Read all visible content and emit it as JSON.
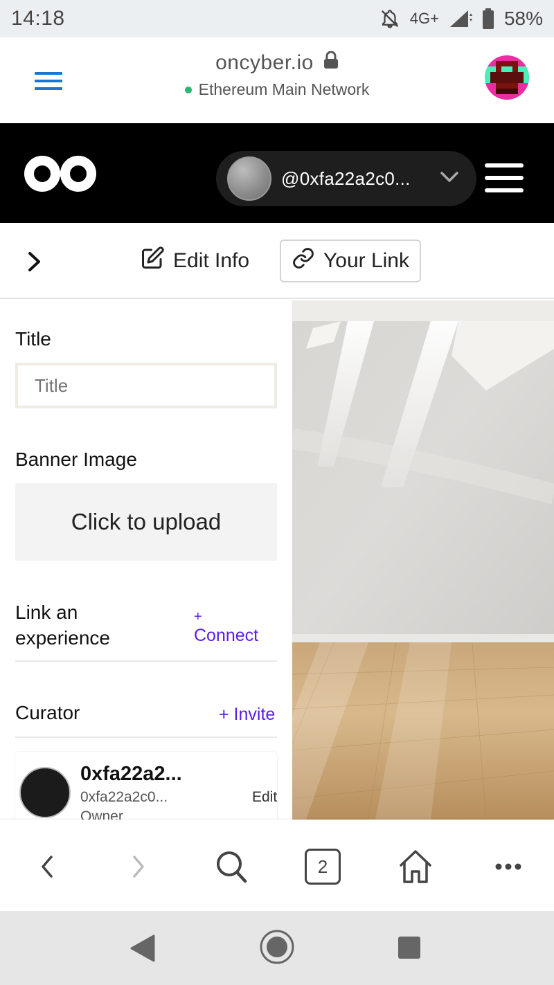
{
  "status_bar": {
    "time": "14:18",
    "network": "4G+",
    "battery": "58%",
    "icons": [
      "bell-off-icon",
      "signal-icon",
      "battery-icon"
    ]
  },
  "browser": {
    "domain": "oncyber.io",
    "network_label": "Ethereum Main Network",
    "network_color": "#2bb673",
    "icons": [
      "hamburger-icon",
      "lock-icon",
      "avatar"
    ],
    "tab_count": "2",
    "nav_icons": [
      "back-icon",
      "forward-icon",
      "search-icon",
      "tabs-icon",
      "home-icon",
      "more-icon"
    ]
  },
  "app": {
    "account_name": "@0xfa22a2c0...",
    "icons": [
      "oncyber-logo",
      "chevron-down-icon",
      "menu-icon"
    ]
  },
  "toolbar": {
    "edit_info_label": "Edit Info",
    "your_link_label": "Your Link",
    "icons": [
      "chevron-right-icon",
      "edit-icon",
      "link-icon"
    ]
  },
  "form": {
    "title_label": "Title",
    "title_placeholder": "Title",
    "banner_label": "Banner Image",
    "upload_label": "Click to upload",
    "link_experience_label_line1": "Link an",
    "link_experience_label_line2": "experience",
    "connect_plus": "+",
    "connect_label": "Connect",
    "curator_label": "Curator",
    "invite_label": "+ Invite",
    "accent_color": "#5b1ee8"
  },
  "curator": {
    "name": "0xfa22a2...",
    "address": "0xfa22a2c0...",
    "role": "Owner",
    "edit_label": "Edit"
  }
}
